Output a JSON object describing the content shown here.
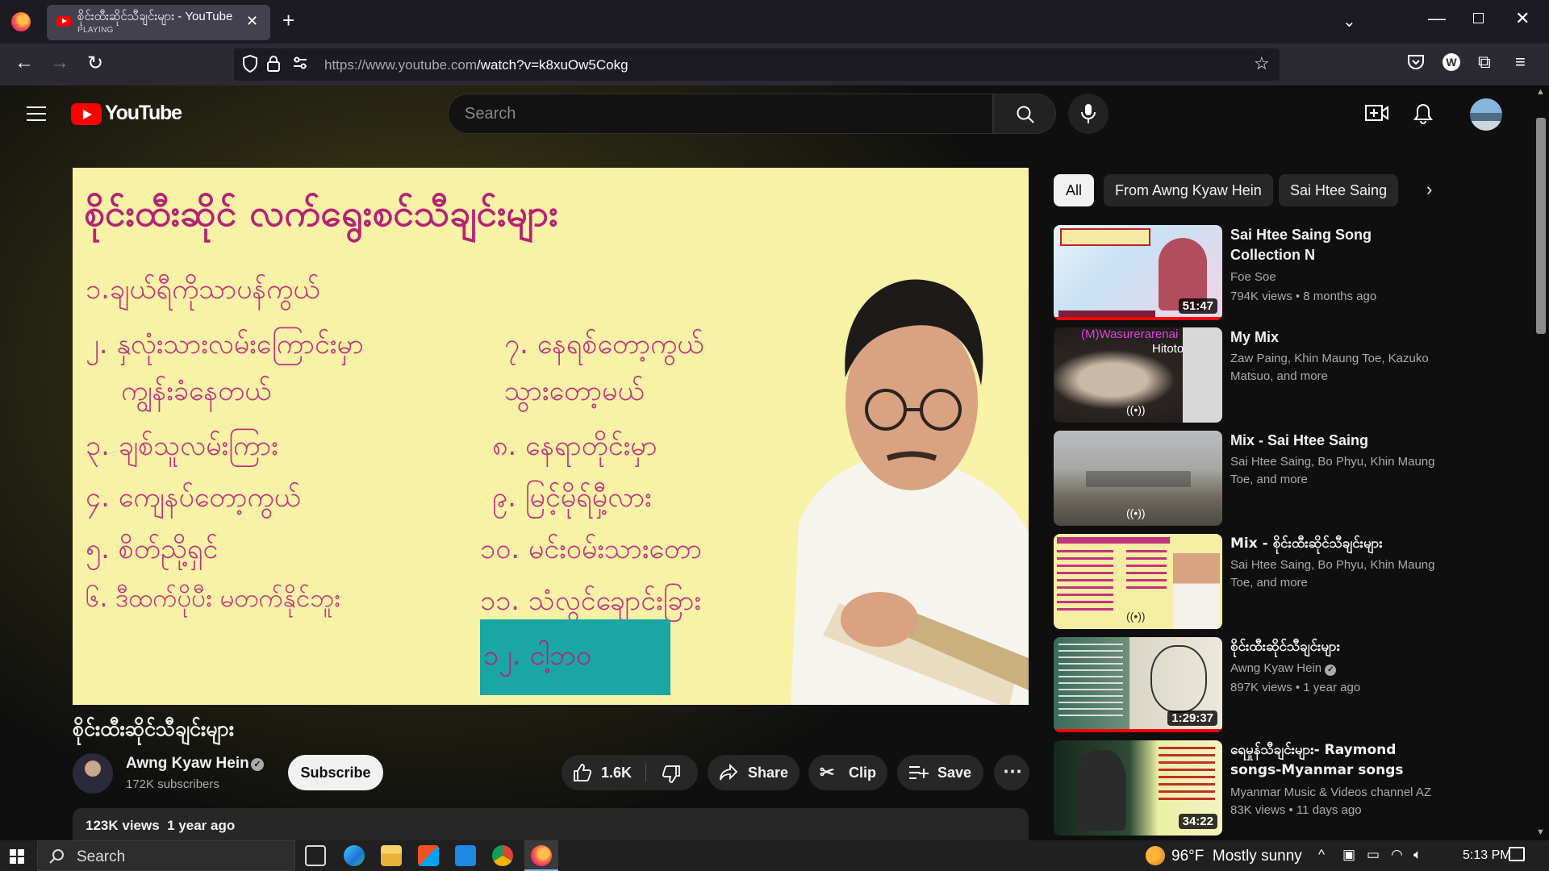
{
  "browser": {
    "tab_title": "စိုင်းထီးဆိုင်သီချင်းများ - YouTube",
    "tab_status": "PLAYING",
    "url_host": "https://www.youtube.com",
    "url_path": "/watch?v=k8xuOw5Cokg"
  },
  "youtube": {
    "logo_text": "YouTube",
    "search_placeholder": "Search"
  },
  "video": {
    "overlay_title": "စိုင်းထီးဆိုင် လက်ရွေးစင်သီချင်းများ",
    "tracklist": [
      "၁.ချယ်ရီကိုသာပန်ကွယ်",
      "၂. နှလုံးသားလမ်းကြောင်းမှာ",
      "ကျွန်းခံနေတယ်",
      "၃. ချစ်သူလမ်းကြား",
      "၄. ကျေနပ်တော့ကွယ်",
      "၅. စိတ်ညို့ရှင်",
      "၆. ဒီထက်ပိုပီး မတက်နိုင်ဘူး",
      "၇. နေရစ်တော့ကွယ်",
      "သွားတော့မယ်",
      "၈. နေရာတိုင်းမှာ",
      "၉. မြင့်မိုရ်မှီ့လား",
      "၁၀. မင်းဝမ်းသားတော",
      "၁၁. သံလွင်ချောင်းခြား",
      "၁၂. ငါ့ဘဝ"
    ],
    "title": "စိုင်းထီးဆိုင်သီချင်းများ",
    "channel": "Awng Kyaw Hein",
    "subscribers": "172K subscribers",
    "subscribe_label": "Subscribe",
    "likes": "1.6K",
    "share_label": "Share",
    "clip_label": "Clip",
    "save_label": "Save",
    "views": "123K views",
    "uploaded": "1 year ago"
  },
  "filters": [
    "All",
    "From Awng Kyaw Hein",
    "Sai Htee Saing"
  ],
  "recommendations": [
    {
      "title": "Sai Htee Saing Song Collection N",
      "channel": "Foe Soe",
      "meta": "794K views • 8 months ago",
      "duration": "51:47"
    },
    {
      "title": "My Mix",
      "channel": "Zaw Paing, Khin Maung Toe, Kazuko Matsuo, and more",
      "meta": "",
      "duration": "",
      "thumb_text_1": "(M)Wasurerarenai",
      "thumb_text_2": "Hitoto Nari"
    },
    {
      "title": "Mix - Sai Htee Saing",
      "channel": "Sai Htee Saing, Bo Phyu, Khin Maung Toe, and more",
      "meta": "",
      "duration": ""
    },
    {
      "title": "Mix - စိုင်းထီးဆိုင်သီချင်းများ",
      "channel": "Sai Htee Saing, Bo Phyu, Khin Maung Toe, and more",
      "meta": "",
      "duration": ""
    },
    {
      "title": "စိုင်းထီးဆိုင်သီချင်းများ",
      "channel": "Awng Kyaw Hein",
      "meta": "897K views • 1 year ago",
      "duration": "1:29:37"
    },
    {
      "title": "ရေမှုန်သီချင်းများ- Raymond songs-Myanmar songs",
      "channel": "Myanmar Music & Videos channel AZ",
      "meta": "83K views • 11 days ago",
      "duration": "34:22"
    }
  ],
  "taskbar": {
    "search_label": "Search",
    "temperature": "96°F",
    "weather": "Mostly sunny",
    "time": "5:13 PM"
  }
}
